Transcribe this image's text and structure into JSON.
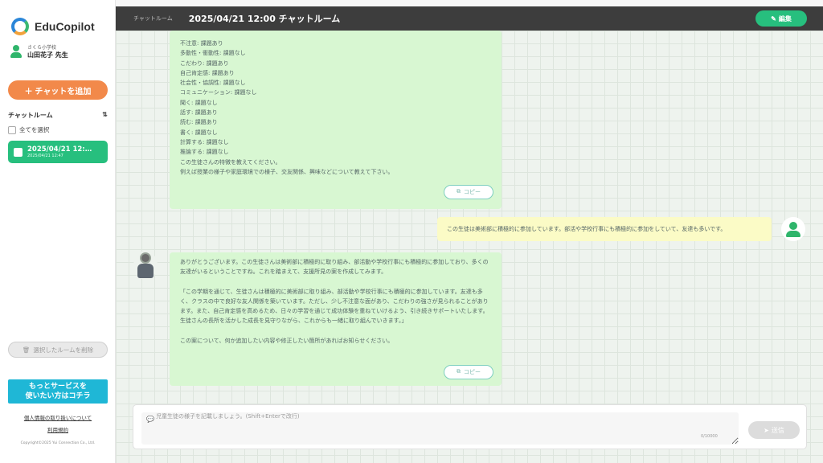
{
  "app": {
    "name": "EduCopilot"
  },
  "user": {
    "school": "さくら小学校",
    "name": "山田花子 先生"
  },
  "sidebar": {
    "add_chat_label": "＋ チャットを追加",
    "rooms_label": "チャットルーム",
    "sort_icon": "⇅",
    "select_all_label": "全てを選択",
    "rooms": [
      {
        "title": "2025/04/21 12:…",
        "date": "2025/04/21 12:47"
      }
    ],
    "delete_label": "選択したルームを削除",
    "promo_line1": "もっとサービスを",
    "promo_line2": "使いたい方はコチラ",
    "privacy_link": "個人情報の取り扱いについて",
    "terms_link": "利用規約",
    "copyright": "Copyright©2025 Yui Connection Co., Ltd."
  },
  "header": {
    "breadcrumb": "チャットルーム",
    "title": "2025/04/21 12:00 チャットルーム",
    "edit_label": "編集"
  },
  "messages": {
    "ai_first_lines": [
      "不注意: 課題あり",
      "多動性・衝動性: 課題なし",
      "こだわり: 課題あり",
      "自己肯定感: 課題あり",
      "社会性・協調性: 課題なし",
      "コミュニケーション: 課題なし",
      "聞く: 課題なし",
      "話す: 課題あり",
      "読む: 課題あり",
      "書く: 課題なし",
      "計算する: 課題なし",
      "推論する: 課題なし",
      "この生徒さんの特徴を教えてください。",
      "例えば授業の様子や家庭環境での様子、交友関係、興味などについて教えて下さい。"
    ],
    "copy_label": "コピー",
    "user_message": "この生徒は美術部に積極的に参加しています。部活や学校行事にも積極的に参加をしていて、友達も多いです。",
    "ai_second_paragraphs": [
      "ありがとうございます。この生徒さんは美術部に積極的に取り組み、部活動や学校行事にも積極的に参加しており、多くの友達がいるということですね。これを踏まえて、支援所見の案を作成してみます。",
      "「この学期を通じて、生徒さんは積極的に美術部に取り組み、部活動や学校行事にも積極的に参加しています。友達も多く、クラスの中で良好な友人関係を築いています。ただし、少し不注意な面があり、こだわりの強さが見られることがあります。また、自己肯定感を高めるため、日々の学習を通じて成功体験を重ねていけるよう、引き続きサポートいたします。生徒さんの長所を活かした成長を見守りながら、これからも一緒に取り組んでいきます。」",
      "この案について、何か追加したい内容や修正したい箇所があればお知らせください。"
    ]
  },
  "input": {
    "placeholder": "児童生徒の様子を記載しましょう。(Shift+Enterで改行)",
    "counter": "0/10000",
    "send_label": "送信"
  },
  "colors": {
    "brand_green": "#27bf7e",
    "orange": "#f2894a",
    "header_bg": "#3d3d3d",
    "ai_bubble": "#d8f7d2",
    "user_bubble": "#fbfbc6",
    "promo": "#1fb7d6"
  }
}
